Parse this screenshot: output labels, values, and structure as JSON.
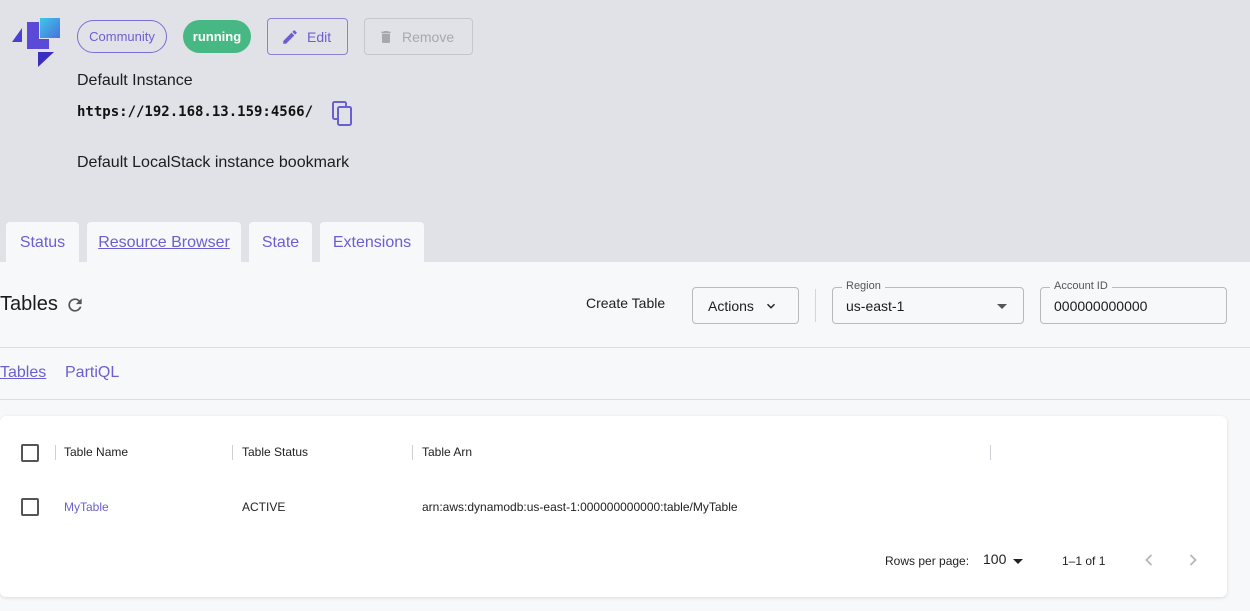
{
  "header": {
    "edition_chip": "Community",
    "status_chip": "running",
    "edit_label": "Edit",
    "remove_label": "Remove",
    "instance_name": "Default Instance",
    "instance_url": "https://192.168.13.159:4566/",
    "instance_description": "Default LocalStack instance bookmark",
    "colors": {
      "accent": "#6b5fd0",
      "running": "#47b883",
      "header_bg": "#e0e2e8"
    }
  },
  "tabs": [
    {
      "label": "Status"
    },
    {
      "label": "Resource Browser",
      "active": true
    },
    {
      "label": "State"
    },
    {
      "label": "Extensions"
    }
  ],
  "toolbar": {
    "title": "Tables",
    "create_label": "Create Table",
    "actions_label": "Actions",
    "region_label": "Region",
    "region_value": "us-east-1",
    "account_label": "Account ID",
    "account_value": "000000000000"
  },
  "subtabs": [
    {
      "label": "Tables",
      "active": true
    },
    {
      "label": "PartiQL"
    }
  ],
  "table": {
    "columns": [
      "Table Name",
      "Table Status",
      "Table Arn"
    ],
    "rows": [
      {
        "name": "MyTable",
        "status": "ACTIVE",
        "arn": "arn:aws:dynamodb:us-east-1:000000000000:table/MyTable"
      }
    ],
    "rows_per_page_label": "Rows per page:",
    "rows_per_page_value": "100",
    "page_info": "1–1 of 1"
  },
  "icons": [
    "localstack-logo",
    "edit-icon",
    "trash-icon",
    "copy-icon",
    "refresh-icon",
    "chevron-down-icon",
    "chevron-left-icon",
    "chevron-right-icon"
  ]
}
